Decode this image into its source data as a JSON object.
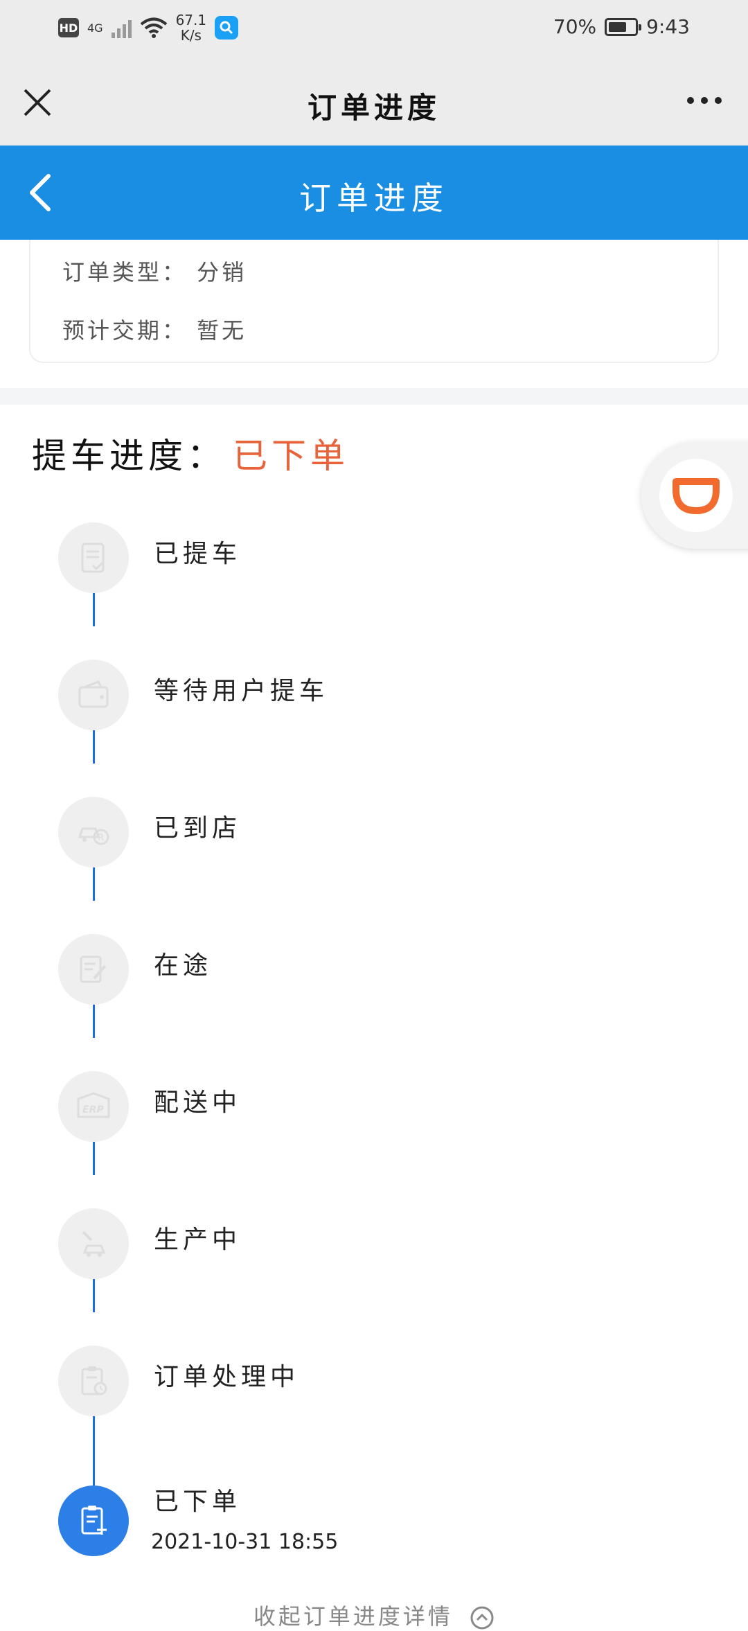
{
  "status_bar": {
    "hd_label": "HD",
    "network_label": "4G",
    "speed_value": "67.1",
    "speed_unit": "K/s",
    "battery_text": "70%",
    "battery_level_percent": 70,
    "time": "9:43"
  },
  "nav": {
    "title": "订单进度",
    "close_icon": "close-icon",
    "more_icon": "more-horizontal-icon"
  },
  "header": {
    "title": "订单进度",
    "back_icon": "chevron-left-icon"
  },
  "order_info": {
    "type_row": "订单类型： 分销",
    "delivery_row": "预计交期： 暂无"
  },
  "pickup": {
    "title": "提车进度：",
    "status": "已下单",
    "status_color": "#e8623a"
  },
  "floating_button": {
    "icon": "didi-logo-icon",
    "brand_color": "#f26a2e"
  },
  "timeline": {
    "line_color": "#1a6de0",
    "active_color": "#2c7fe6",
    "steps": [
      {
        "label": "已提车",
        "icon": "checklist-icon",
        "active": false
      },
      {
        "label": "等待用户提车",
        "icon": "wallet-icon",
        "active": false
      },
      {
        "label": "已到店",
        "icon": "car-store-icon",
        "active": false
      },
      {
        "label": "在途",
        "icon": "edit-note-icon",
        "active": false
      },
      {
        "label": "配送中",
        "icon": "erp-box-icon",
        "active": false
      },
      {
        "label": "生产中",
        "icon": "factory-car-icon",
        "active": false
      },
      {
        "label": "订单处理中",
        "icon": "clipboard-clock-icon",
        "active": false
      },
      {
        "label": "已下单",
        "icon": "clipboard-add-icon",
        "active": true,
        "time": "2021-10-31 18:55"
      }
    ]
  },
  "footer": {
    "collapse_label": "收起订单进度详情",
    "collapse_icon": "chevron-up-circle-icon"
  }
}
